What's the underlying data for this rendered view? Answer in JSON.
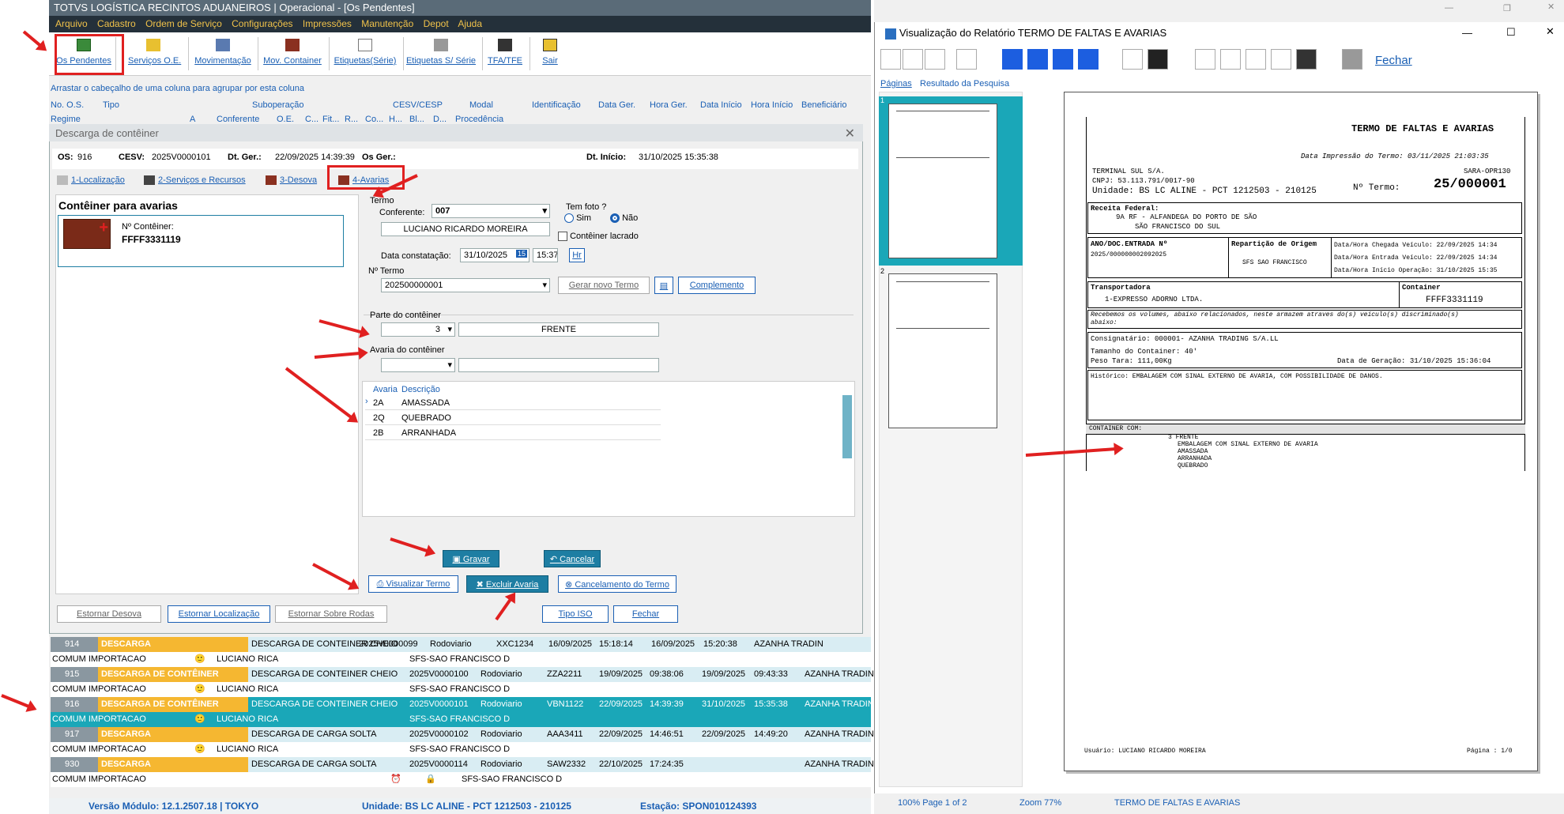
{
  "app": {
    "title": "TOTVS LOGÍSTICA RECINTOS ADUANEIROS | Operacional - [Os Pendentes]",
    "menu": [
      "Arquivo",
      "Cadastro",
      "Ordem de Serviço",
      "Configurações",
      "Impressões",
      "Manutenção",
      "Depot",
      "Ajuda"
    ],
    "toolbar": [
      "Os Pendentes",
      "Serviços O.E.",
      "Movimentação",
      "Mov. Container",
      "Etiquetas(Série)",
      "Etiquetas S/ Série",
      "TFA/TFE",
      "Sair"
    ],
    "group_hint": "Arrastar o cabeçalho de uma coluna para agrupar por esta coluna",
    "columns": [
      "No. O.S.",
      "Tipo",
      "Suboperação",
      "CESV/CESP",
      "Modal",
      "Identificação",
      "Data Ger.",
      "Hora Ger.",
      "Data Início",
      "Hora Início",
      "Beneficiário"
    ],
    "columns2": [
      "Regime",
      "A",
      "Conferente",
      "O.E.",
      "C...",
      "Fit...",
      "R...",
      "Co...",
      "H...",
      "Bl...",
      "D...",
      "Procedência"
    ]
  },
  "dialog": {
    "title": "Descarga de contêiner",
    "os_label": "OS:",
    "os": "916",
    "cesv_label": "CESV:",
    "cesv": "2025V0000101",
    "dtger_label": "Dt. Ger.:",
    "dtger": "22/09/2025 14:39:39",
    "osger_label": "Os Ger.:",
    "dtini_label": "Dt. Início:",
    "dtini": "31/10/2025 15:35:38",
    "tabs": [
      "1-Localização",
      "2-Serviços e Recursos",
      "3-Desova",
      "4-Avarias"
    ],
    "left_title": "Contêiner para avarias",
    "container_label": "Nº Contêiner:",
    "container": "FFFF3331119",
    "termo_label": "Termo",
    "conferente_label": "Conferente:",
    "conferente": "007",
    "conferente_name": "LUCIANO RICARDO MOREIRA",
    "tem_foto": "Tem foto ?",
    "sim": "Sim",
    "nao": "Não",
    "lacrado": "Contêiner lacrado",
    "data_const_label": "Data constatação:",
    "data_const": "31/10/2025",
    "hora_const": "15:37",
    "hr": "Hr",
    "num_termo_label": "Nº Termo",
    "num_termo": "202500000001",
    "gerar": "Gerar novo Termo",
    "complemento": "Complemento",
    "parte_label": "Parte do contêiner",
    "parte_code": "3",
    "parte_desc": "FRENTE",
    "avaria_label": "Avaria do contêiner",
    "grid_head": [
      "Avaria",
      "Descrição"
    ],
    "grid": [
      [
        "2A",
        "AMASSADA"
      ],
      [
        "2Q",
        "QUEBRADO"
      ],
      [
        "2B",
        "ARRANHADA"
      ]
    ],
    "gravar": "Gravar",
    "cancelar": "Cancelar",
    "visualizar": "Visualizar Termo",
    "excluir": "Excluir Avaria",
    "cancelamento": "Cancelamento do Termo",
    "estornar_desova": "Estornar Desova",
    "estornar_local": "Estornar Localização",
    "estornar_rodas": "Estornar Sobre Rodas",
    "tipo_iso": "Tipo ISO",
    "fechar": "Fechar"
  },
  "rows": [
    {
      "no": "914",
      "tipo": "DESCARGA",
      "sub": "DESCARGA DE CONTEINER CHEIO",
      "cesv": "",
      "modal": "",
      "ident": "",
      "dg": "",
      "hg": "",
      "di": "",
      "hi": "",
      "ben": "",
      "reg": "COMUM IMPORTACAO",
      "conf": "LUCIANO RICA",
      "proc": ""
    },
    {
      "no": "",
      "tipo": "",
      "sub": "",
      "cesv": "2025V0000099",
      "modal": "Rodoviario",
      "ident": "XXC1234",
      "dg": "16/09/2025",
      "hg": "15:18:14",
      "di": "16/09/2025",
      "hi": "15:20:38",
      "ben": "AZANHA TRADIN",
      "reg": "",
      "conf": "",
      "proc": "SFS-SAO FRANCISCO D"
    },
    {
      "no": "915",
      "tipo": "DESCARGA DE CONTÊINER",
      "sub": "DESCARGA DE CONTEINER CHEIO",
      "cesv": "2025V0000100",
      "modal": "Rodoviario",
      "ident": "ZZA2211",
      "dg": "19/09/2025",
      "hg": "09:38:06",
      "di": "19/09/2025",
      "hi": "09:43:33",
      "ben": "AZANHA TRADIN",
      "reg": "COMUM IMPORTACAO",
      "conf": "LUCIANO RICA",
      "proc": "SFS-SAO FRANCISCO D"
    },
    {
      "no": "916",
      "tipo": "DESCARGA DE CONTÊINER",
      "sub": "DESCARGA DE CONTEINER CHEIO",
      "cesv": "2025V0000101",
      "modal": "Rodoviario",
      "ident": "VBN1122",
      "dg": "22/09/2025",
      "hg": "14:39:39",
      "di": "31/10/2025",
      "hi": "15:35:38",
      "ben": "AZANHA TRADIN",
      "reg": "COMUM IMPORTACAO",
      "conf": "LUCIANO RICA",
      "proc": "SFS-SAO FRANCISCO D"
    },
    {
      "no": "917",
      "tipo": "DESCARGA",
      "sub": "DESCARGA DE CARGA SOLTA",
      "cesv": "2025V0000102",
      "modal": "Rodoviario",
      "ident": "AAA3411",
      "dg": "22/09/2025",
      "hg": "14:46:51",
      "di": "22/09/2025",
      "hi": "14:49:20",
      "ben": "AZANHA TRADIN",
      "reg": "COMUM IMPORTACAO",
      "conf": "LUCIANO RICA",
      "proc": "SFS-SAO FRANCISCO D"
    },
    {
      "no": "930",
      "tipo": "DESCARGA",
      "sub": "DESCARGA DE CARGA SOLTA",
      "cesv": "2025V0000114",
      "modal": "Rodoviario",
      "ident": "SAW2332",
      "dg": "22/10/2025",
      "hg": "17:24:35",
      "di": "",
      "hi": "",
      "ben": "AZANHA TRADIN",
      "reg": "COMUM IMPORTACAO",
      "conf": "",
      "proc": "SFS-SAO FRANCISCO D"
    }
  ],
  "status": {
    "versao": "Versão Módulo:  12.1.2507.18  |  TOKYO",
    "unidade": "Unidade:  BS LC ALINE - PCT 1212503 - 210125",
    "estacao": "Estação:  SPON010124393"
  },
  "preview": {
    "title": "Visualização do Relatório TERMO DE FALTAS E AVARIAS",
    "fechar": "Fechar",
    "tabs": [
      "Páginas",
      "Resultado da Pesquisa"
    ],
    "thumb_nums": [
      "1",
      "2"
    ],
    "status": [
      "100% Page 1 of 2",
      "Zoom 77%",
      "TERMO DE FALTAS E AVARIAS"
    ],
    "report": {
      "title": "TERMO DE FALTAS E AVARIAS",
      "impressao": "Data Impressão do Termo: 03/11/2025  21:03:35",
      "terminal": "TERMINAL SUL S/A.",
      "sara": "SARA-OPR130",
      "cnpj": "CNPJ: 53.113.791/0017-90",
      "unidade": "Unidade: BS LC ALINE - PCT 1212503 - 210125",
      "termo_label": "Nº Termo:",
      "termo": "25/000001",
      "receita": "Receita Federal:",
      "receita1": "9A RF - ALFANDEGA DO PORTO DE SÃO",
      "receita2": "SÃO FRANCISCO DO SUL",
      "ano_doc": "ANO/DOC.ENTRADA Nº",
      "ano_doc_val": "2025/000000002092025",
      "reparticao": "Repartição de Origem",
      "reparticao_val": "SFS  SAO FRANCISCO",
      "chegada": "Data/Hora Chegada Veículo: 22/09/2025 14:34",
      "entrada": "Data/Hora Entrada Veículo: 22/09/2025 14:34",
      "inicio": "Data/Hora Início Operação: 31/10/2025 15:35",
      "transp_label": "Transportadora",
      "transp": "1-EXPRESSO ADORNO LTDA.",
      "container_label": "Container",
      "container": "FFFF3331119",
      "recebemos": "Recebemos os volumes, abaixo relacionados, neste armazem atraves do(s) veículo(s) discriminado(s)",
      "abaixo": "abaixo:",
      "consig": "Consignatário:      000001- AZANHA TRADING S/A.LL",
      "tamanho": "Tamanho do Container:       40'",
      "peso": "Peso Tara:                 111,00Kg",
      "geracao": "Data de Geração: 31/10/2025 15:36:04",
      "historico": "Histórico: EMBALAGEM COM SINAL EXTERNO DE AVARIA, COM POSSIBILIDADE DE DANOS.",
      "container_com": "CONTAINER COM:",
      "items": [
        "3 FRENTE",
        "EMBALAGEM COM SINAL EXTERNO DE AVARIA",
        "AMASSADA",
        "ARRANHADA",
        "QUEBRADO"
      ],
      "usuario": "Usuário: LUCIANO RICARDO MOREIRA",
      "pagina": "Página : 1/0"
    }
  },
  "colors": {
    "accent": "#1e7ea3",
    "orange": "#f5b731",
    "selected": "#1aa7b8",
    "red": "#e02020",
    "menu": "#24303a"
  }
}
